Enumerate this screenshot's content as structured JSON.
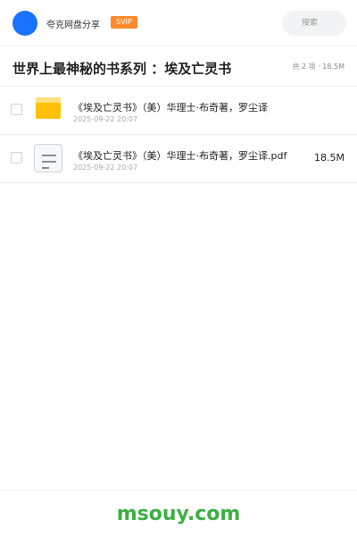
{
  "header": {
    "app_name": "夸克网盘分享",
    "badge": "SVIP",
    "search_placeholder": "搜索"
  },
  "folder": {
    "title": "世界上最神秘的书系列 ：埃及亡灵书",
    "summary": "共 2 项 · 18.5M"
  },
  "files": [
    {
      "name": "《埃及亡灵书》（美）华理士·布奇著，罗尘译",
      "date": "2025-09-22 20:07",
      "size": "",
      "icon": "folder-icon"
    },
    {
      "name": "《埃及亡灵书》（美）华理士·布奇著，罗尘译.pdf",
      "date": "2025-09-22 20:07",
      "size": "18.5M",
      "icon": "document-icon"
    }
  ],
  "footer": {
    "watermark": "msouy.com"
  },
  "colors": {
    "accent_blue": "#1a73ff",
    "svip_orange": "#ff8a2b",
    "folder_yellow": "#ffc107",
    "watermark_green": "#3cb043"
  }
}
